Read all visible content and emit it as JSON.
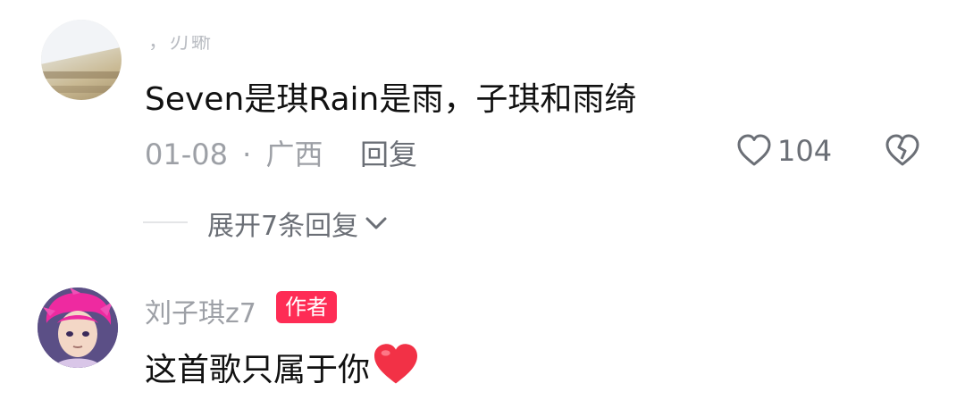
{
  "comment1": {
    "username": "，刃蜥",
    "text": "Seven是琪Rain是雨，子琪和雨绮",
    "date": "01-08",
    "separator": "·",
    "location": "广西",
    "reply_label": "回复",
    "like_count": "104"
  },
  "expand": {
    "label": "展开7条回复"
  },
  "comment2": {
    "username": "刘子琪z7",
    "author_badge": "作者",
    "text": "这首歌只属于你"
  },
  "colors": {
    "badge": "#fe2c55",
    "heart": "#f23146"
  }
}
